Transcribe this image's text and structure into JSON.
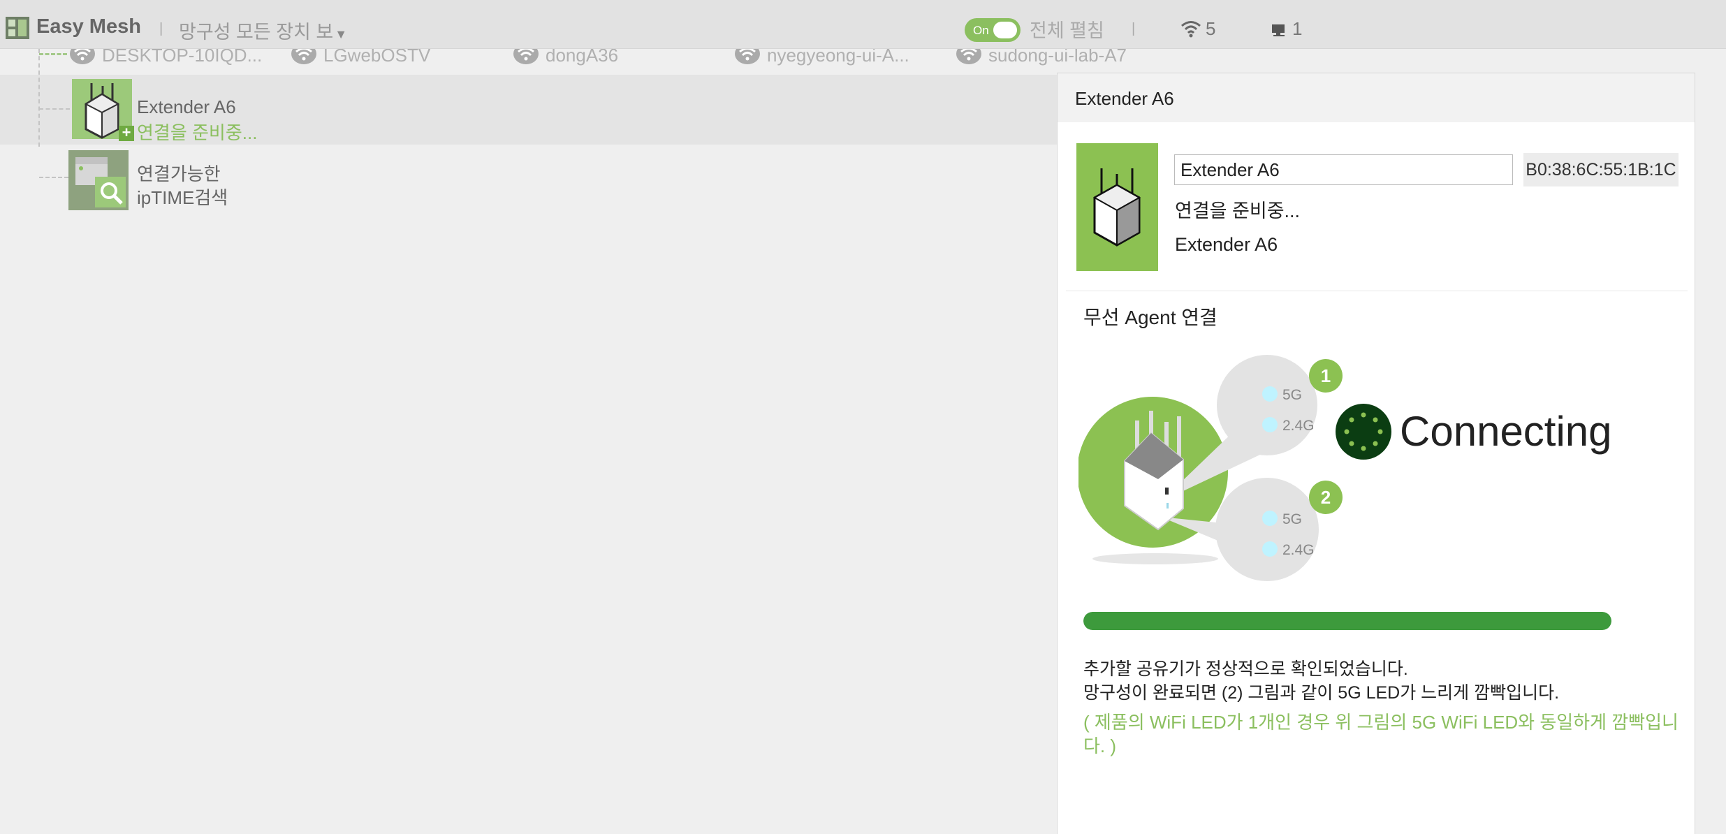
{
  "app": {
    "title": "Easy Mesh",
    "view_select": "망구성 모든 장치 보"
  },
  "topbar": {
    "toggle_label": "On",
    "expand_all": "전체 펼침",
    "wifi_count": "5",
    "wired_count": "1"
  },
  "clients": [
    {
      "name": "DESKTOP-10IQD..."
    },
    {
      "name": "LGwebOSTV"
    },
    {
      "name": "dongA36"
    },
    {
      "name": "nyegyeong-ui-A..."
    },
    {
      "name": "sudong-ui-lab-A7"
    }
  ],
  "tree": {
    "extender": {
      "name": "Extender A6",
      "status": "연결을 준비중..."
    },
    "search": {
      "line1": "연결가능한",
      "line2": "ipTIME검색"
    }
  },
  "panel": {
    "title": "Extender A6",
    "device_name": "Extender A6",
    "mac": "B0:38:6C:55:1B:1C",
    "status": "연결을 준비중...",
    "model": "Extender A6",
    "section_title": "무선 Agent 연결",
    "illustration": {
      "step1": "1",
      "step2": "2",
      "band_5g": "5G",
      "band_24g": "2.4G",
      "connecting": "Connecting"
    },
    "progress_percent": 100,
    "message_line1": "추가할 공유기가 정상적으로 확인되었습니다.",
    "message_line2": "망구성이 완료되면 (2) 그림과 같이 5G LED가 느리게 깜빡입니다.",
    "note": "( 제품의 WiFi LED가 1개인 경우 위 그림의 5G WiFi LED와 동일하게 깜빡입니다. )"
  },
  "colors": {
    "accent": "#8bbf5f",
    "progress": "#3d9a3c",
    "node_bg": "#9cc97a"
  }
}
